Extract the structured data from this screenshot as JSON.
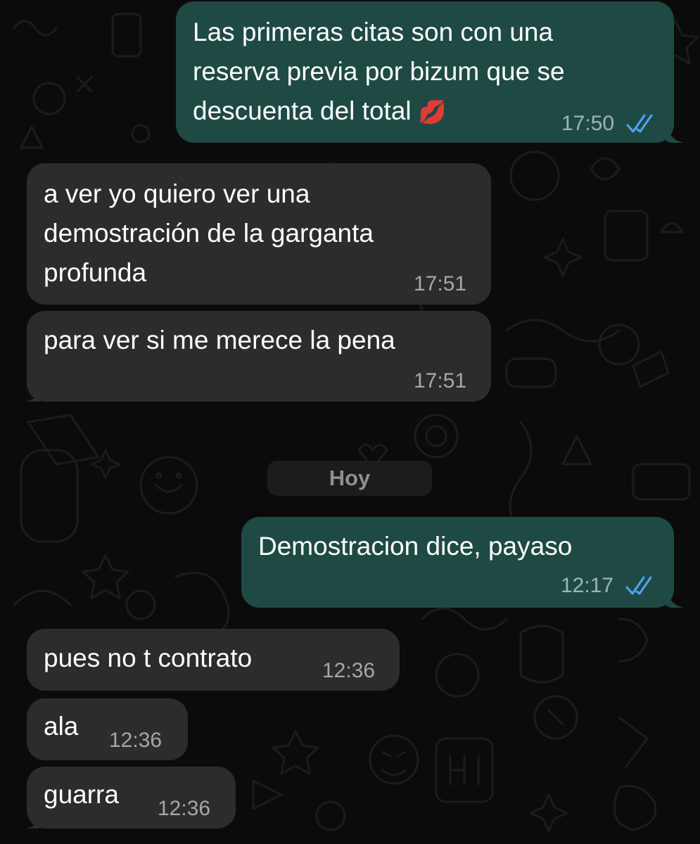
{
  "chat": {
    "date_separator": "Hoy",
    "messages": [
      {
        "direction": "outgoing",
        "text": "Las primeras citas son con una\nreserva previa por bizum que se\ndescuenta del total",
        "emoji": "💋",
        "time": "17:50",
        "status": "read"
      },
      {
        "direction": "incoming",
        "text": "a ver yo quiero ver una\ndemostración de la garganta\nprofunda",
        "time": "17:51"
      },
      {
        "direction": "incoming",
        "text": "para ver si me merece la pena",
        "time": "17:51"
      },
      {
        "direction": "outgoing",
        "text": "Demostracion dice, payaso",
        "time": "12:17",
        "status": "read"
      },
      {
        "direction": "incoming",
        "text": "pues no t contrato",
        "time": "12:36"
      },
      {
        "direction": "incoming",
        "text": "ala",
        "time": "12:36"
      },
      {
        "direction": "incoming",
        "text": "guarra",
        "time": "12:36"
      }
    ]
  },
  "colors": {
    "background": "#0b0b0b",
    "outgoing_bubble": "#1f4a44",
    "incoming_bubble": "#2c2c2e",
    "read_ticks": "#4fa3ff",
    "timestamp": "#a3a3a3"
  },
  "icons": {
    "read_receipt": "double-check-icon",
    "lips_emoji": "💋"
  }
}
